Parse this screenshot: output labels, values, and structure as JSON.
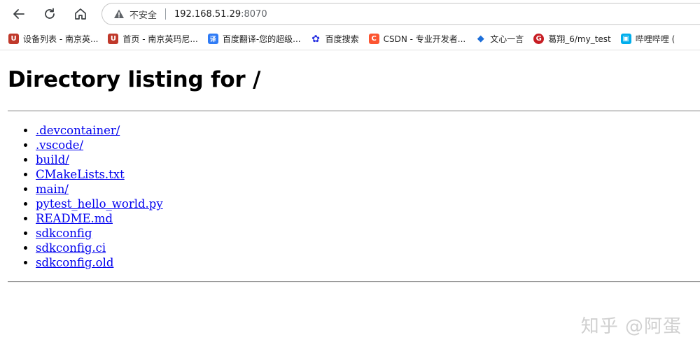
{
  "toolbar": {
    "security_label": "不安全",
    "url_host": "192.168.51.29",
    "url_port": ":8070"
  },
  "bookmarks": [
    {
      "label": "设备列表 - 南京英...",
      "icon": "bookmark-u-icon",
      "color": "#c0392b",
      "glyph": "U"
    },
    {
      "label": "首页 - 南京英玛尼...",
      "icon": "bookmark-u-icon",
      "color": "#c0392b",
      "glyph": "U"
    },
    {
      "label": "百度翻译-您的超级...",
      "icon": "translate-icon",
      "color": "#2f7bf5",
      "glyph": "译"
    },
    {
      "label": "百度搜索",
      "icon": "baidu-paw-icon",
      "color": "#2932e1",
      "glyph": "✿"
    },
    {
      "label": "CSDN - 专业开发者...",
      "icon": "csdn-icon",
      "color": "#fc5531",
      "glyph": "C"
    },
    {
      "label": "文心一言",
      "icon": "wenxin-icon",
      "color": "#1e6fd9",
      "glyph": "◆"
    },
    {
      "label": "葛翔_6/my_test",
      "icon": "gitee-icon",
      "color": "#c71d23",
      "glyph": "G"
    },
    {
      "label": "哔哩哔哩 (",
      "icon": "bilibili-icon",
      "color": "#00aeec",
      "glyph": "▣"
    }
  ],
  "page": {
    "heading": "Directory listing for /",
    "entries": [
      ".devcontainer/",
      ".vscode/",
      "build/",
      "CMakeLists.txt",
      "main/",
      "pytest_hello_world.py",
      "README.md",
      "sdkconfig",
      "sdkconfig.ci",
      "sdkconfig.old"
    ]
  },
  "watermark": "知乎 @阿蛋"
}
